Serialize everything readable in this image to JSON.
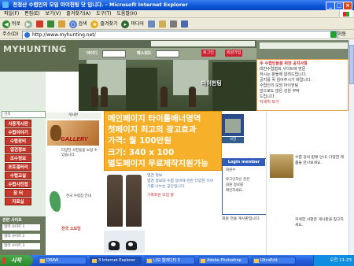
{
  "window": {
    "title": "천정산 수렵인의 모임 마이헌팅 닷 입니다. - Microsoft Internet Explorer"
  },
  "menubar": {
    "items": [
      "파일(F)",
      "편집(E)",
      "보기(V)",
      "즐겨찾기(A)",
      "도구(T)",
      "도움말(H)"
    ]
  },
  "toolbar": {
    "back": "뒤로",
    "search": "검색",
    "favorites": "즐겨찾기",
    "media": "미디어"
  },
  "address": {
    "label": "주소(D)",
    "url": "http://www.myhunting.net/",
    "go": "이동"
  },
  "site": {
    "logo": "MYHUNTING",
    "id_label": "아이디",
    "pw_label": "패스워드",
    "login": "로그인",
    "join": "회원가입",
    "photo_caption": "마이헌팅",
    "notice_lines": [
      "※ 수렵인들을 위한 공지사항",
      "대한수렵협회 사이트에 방문",
      "하시는 분들께 알려드립니다.",
      "공지를 꼭 읽어주시기 바랍니다.",
      "수렵인의 모임 마이헌팅",
      "앞으로도 많은 성원 부탁",
      "드립니다."
    ],
    "notice_more": "자세히 보기",
    "search_placeholder": "검색",
    "left_menu": [
      "사용게시판",
      "수렵이야기",
      "수렵장비",
      "엽견정보",
      "조수정보",
      "포토갤러리",
      "수렵교실",
      "수렵사진첩",
      "장   터",
      "자료실"
    ],
    "partner_title": "관련 사이트",
    "partner_banners": [
      "협력 사이트 1",
      "협력 사이트 2",
      "협력 사이트 3"
    ],
    "gallery_header": "게시판",
    "gallery_label": "GALLERY",
    "gallery_text": "다양한 사진들을 보실 수 있습니다.",
    "map_text": "전국 수렵장 안내",
    "regional_title": "전국 소모임",
    "ad_lines": [
      "메인페이지 타이틀배너영역",
      "첫페이지 최고의 광고효과",
      "가격: 월 100만원",
      "크기: 340 x 100",
      "별도페이지 무료제작지원가능"
    ],
    "article_title": "엽견 정보",
    "article_body": "엽견 정보와 수렵 장비에 관한 다양한 이야기를 나누는 공간입니다.",
    "article_red": "가족회원 모집 중",
    "photo_tag": "사진",
    "login_box_title": "Login member",
    "login_box_lines": [
      "회원수",
      "로그인하신 분은",
      "회원 정보를",
      "확인하세요."
    ],
    "right_note": "회원 전용 게시판입니다.",
    "right_text": "수렵 장비 판매 안내. 다양한 제품을 만나보세요.",
    "right_text2": "자세한 사항은 게시판을 참고하세요."
  },
  "taskbar": {
    "start": "시작",
    "items": [
      "DRAW",
      "3 Internet Explorer",
      "나모 웹에디터 5",
      "Adobe Photoshop",
      "UltraEdit"
    ],
    "clock": "오전 11:23"
  }
}
